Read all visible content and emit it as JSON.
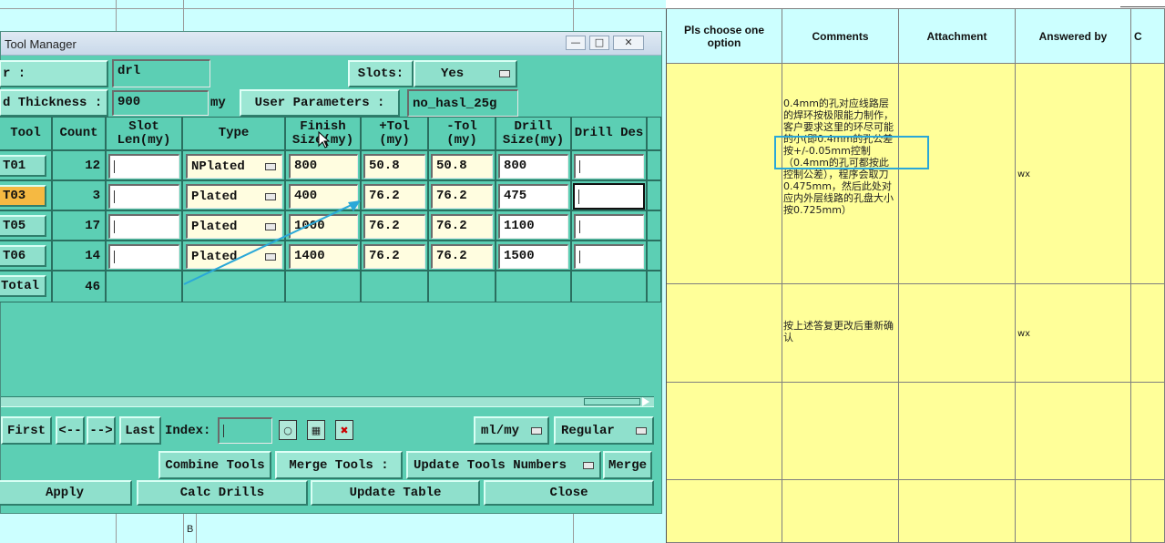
{
  "sheet": {
    "bottom_cell_b": "B"
  },
  "right_table": {
    "headers": [
      "Pls choose one option",
      "Comments",
      "Attachment",
      "Answered by",
      "C"
    ],
    "rows": [
      {
        "comment": "0.4mm的孔对应线路层的焊环按极限能力制作，客户要求这里的环尽可能的小(即0.4mm的孔公差按+/-0.05mm控制（0.4mm的孔可都按此控制公差），程序会取刀0.475mm，然后此处对应内外层线路的孔盘大小按0.725mm）",
        "answered_by": "wx"
      },
      {
        "comment": "按上述答复更改后重新确认",
        "answered_by": "wx"
      },
      {
        "comment": "",
        "answered_by": ""
      },
      {
        "comment": "",
        "answered_by": ""
      }
    ]
  },
  "window": {
    "title": "Tool Manager",
    "controls": [
      "—",
      "□",
      "✕"
    ],
    "layer_label": "r             :",
    "layer_value": "drl",
    "slots_label": "Slots:",
    "slots_value": "Yes",
    "thickness_label": "d Thickness :",
    "thickness_value": "900",
    "thickness_unit": "my",
    "user_params_label": "User Parameters :",
    "user_params_value": "no_hasl_25g",
    "columns": [
      "Tool",
      "Count",
      "Slot Len(my)",
      "Type",
      "Finish Size(my)",
      "+Tol (my)",
      "-Tol (my)",
      "Drill Size(my)",
      "Drill Des"
    ],
    "rows": [
      {
        "tool": "T01",
        "count": "12",
        "slot": "",
        "type": "NPlated",
        "finish": "800",
        "ptol": "50.8",
        "ntol": "50.8",
        "drill": "800",
        "des": ""
      },
      {
        "tool": "T03",
        "count": "3",
        "slot": "",
        "type": "Plated",
        "finish": "400",
        "ptol": "76.2",
        "ntol": "76.2",
        "drill": "475",
        "des": ""
      },
      {
        "tool": "T05",
        "count": "17",
        "slot": "",
        "type": "Plated",
        "finish": "1000",
        "ptol": "76.2",
        "ntol": "76.2",
        "drill": "1100",
        "des": ""
      },
      {
        "tool": "T06",
        "count": "14",
        "slot": "",
        "type": "Plated",
        "finish": "1400",
        "ptol": "76.2",
        "ntol": "76.2",
        "drill": "1500",
        "des": ""
      }
    ],
    "total_label": "Total",
    "total_count": "46",
    "nav": {
      "first": "First",
      "prev": "<--",
      "next": "-->",
      "last": "Last",
      "index_label": "Index:",
      "index_value": "",
      "units": "ml/my",
      "mode": "Regular"
    },
    "combine_tools": "Combine Tools",
    "merge_tools_label": "Merge Tools :",
    "merge_mode": "Update Tools Numbers",
    "merge_button": "Merge",
    "apply": "Apply",
    "calc_drills": "Calc Drills",
    "update_table": "Update Table",
    "close": "Close"
  },
  "colors": {
    "window_bg": "#5ccfb4",
    "field_bg": "#fffde0",
    "selected_tool": "#f5b942",
    "highlight_box": "#2aa8d8",
    "comment_bg": "#ffff99",
    "header_bg": "#ccffff"
  }
}
